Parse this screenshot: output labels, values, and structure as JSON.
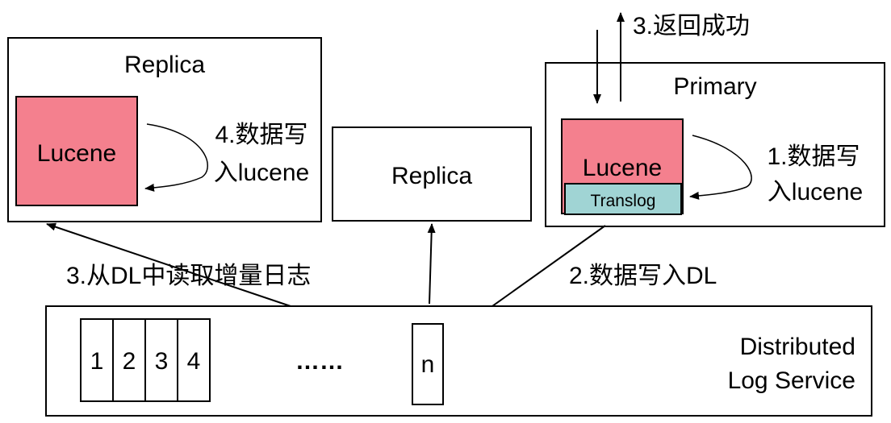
{
  "colors": {
    "lucene_fill": "#F4808E",
    "translog_fill": "#A0D4D4",
    "stroke": "#000000",
    "background": "#FFFFFF"
  },
  "replica_left": {
    "title": "Replica",
    "lucene_label": "Lucene",
    "step_label_line1": "4.数据写",
    "step_label_line2": "入lucene"
  },
  "replica_middle": {
    "title": "Replica"
  },
  "primary": {
    "title": "Primary",
    "lucene_label": "Lucene",
    "translog_label": "Translog",
    "step_label_line1": "1.数据写",
    "step_label_line2": "入lucene"
  },
  "top_return_label": "3.返回成功",
  "write_dl_label": "2.数据写入DL",
  "read_dl_label": "3.从DL中读取增量日志",
  "log_service": {
    "title_line1": "Distributed",
    "title_line2": "Log Service",
    "cells": [
      "1",
      "2",
      "3",
      "4"
    ],
    "ellipsis": "……",
    "last_cell": "n"
  }
}
